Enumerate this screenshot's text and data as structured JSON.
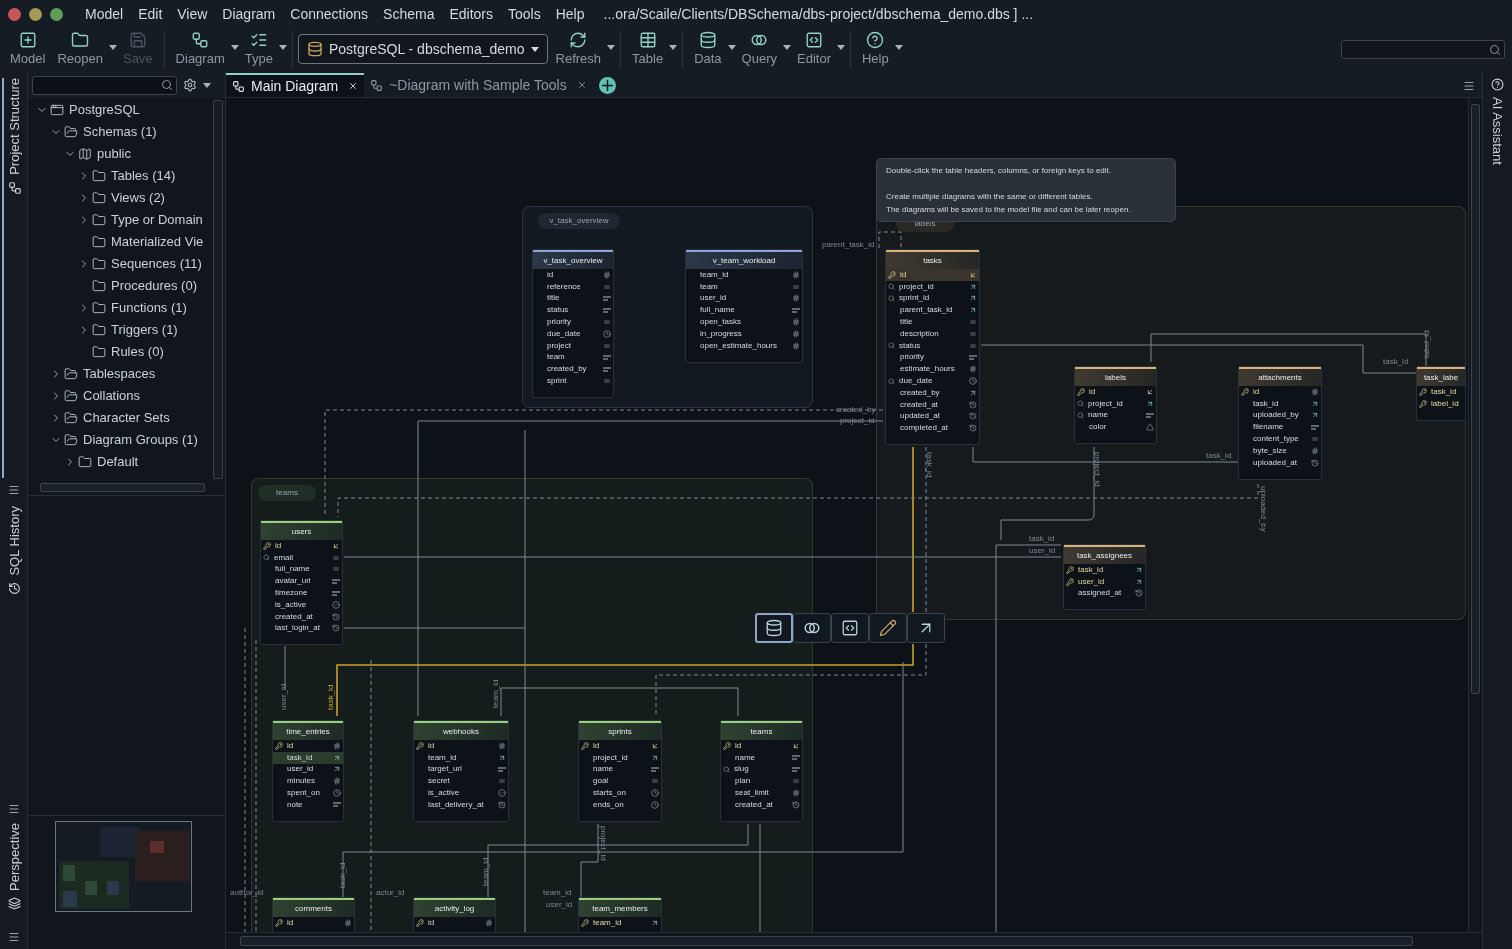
{
  "menu_bar": {
    "items": [
      "Model",
      "Edit",
      "View",
      "Diagram",
      "Connections",
      "Schema",
      "Editors",
      "Tools",
      "Help"
    ],
    "path": "...ora/Scaile/Clients/DBSchema/dbs-project/dbschema_demo.dbs ] ..."
  },
  "toolbar": {
    "buttons": [
      {
        "label": "Model",
        "disabled": false,
        "dropdown": false
      },
      {
        "label": "Reopen",
        "disabled": false,
        "dropdown": true
      },
      {
        "label": "Save",
        "disabled": true,
        "dropdown": false
      },
      {
        "label": "Diagram",
        "disabled": false,
        "dropdown": true
      },
      {
        "label": "Type",
        "disabled": false,
        "dropdown": true
      },
      {
        "label": "Refresh",
        "disabled": false,
        "dropdown": true
      },
      {
        "label": "Table",
        "disabled": false,
        "dropdown": true
      },
      {
        "label": "Data",
        "disabled": false,
        "dropdown": true
      },
      {
        "label": "Query",
        "disabled": false,
        "dropdown": true
      },
      {
        "label": "Editor",
        "disabled": false,
        "dropdown": true
      },
      {
        "label": "Help",
        "disabled": false,
        "dropdown": true
      }
    ],
    "connection": "PostgreSQL - dbschema_demo"
  },
  "side_tabs": {
    "left": [
      {
        "label": "Project Structure",
        "selected": true
      },
      {
        "label": "SQL History",
        "selected": false
      },
      {
        "label": "Perspective",
        "selected": false
      }
    ],
    "right": [
      "AI Assistant"
    ]
  },
  "tree": [
    {
      "label": "PostgreSQL",
      "kind": "database",
      "expanded": true,
      "children": [
        {
          "label": "Schemas (1)",
          "kind": "group",
          "expanded": true,
          "children": [
            {
              "label": "public",
              "kind": "schema",
              "expanded": true,
              "children": [
                {
                  "label": "Tables (14)",
                  "kind": "folder",
                  "expanded": false
                },
                {
                  "label": "Views (2)",
                  "kind": "folder",
                  "expanded": false
                },
                {
                  "label": "Type or Domain",
                  "kind": "folder",
                  "expanded": false
                },
                {
                  "label": "Materialized Vie",
                  "kind": "folder"
                },
                {
                  "label": "Sequences (11)",
                  "kind": "folder",
                  "expanded": false
                },
                {
                  "label": "Procedures (0)",
                  "kind": "folder"
                },
                {
                  "label": "Functions (1)",
                  "kind": "folder",
                  "expanded": false
                },
                {
                  "label": "Triggers (1)",
                  "kind": "folder",
                  "expanded": false
                },
                {
                  "label": "Rules (0)",
                  "kind": "folder"
                }
              ]
            }
          ]
        },
        {
          "label": "Tablespaces",
          "kind": "group",
          "expanded": false
        },
        {
          "label": "Collations",
          "kind": "group",
          "expanded": false
        },
        {
          "label": "Character Sets",
          "kind": "group",
          "expanded": false
        },
        {
          "label": "Diagram Groups (1)",
          "kind": "group",
          "expanded": true,
          "children": [
            {
              "label": "Default",
              "kind": "folder",
              "expanded": false
            }
          ]
        }
      ]
    }
  ],
  "tabs": [
    {
      "label": "Main Diagram",
      "selected": true
    },
    {
      "label": "~Diagram with Sample Tools",
      "selected": false
    }
  ],
  "diagram": {
    "groups": [
      {
        "title": "v_task_overview",
        "color": "#8fa5d8"
      },
      {
        "title": "teams",
        "color": "#9ad07a"
      },
      {
        "title": "labels",
        "color": "#d9b27a"
      }
    ],
    "tooltip": [
      "Double-click the table headers, columns, or foreign keys to edit.",
      "Create multiple diagrams with the same or different tables.",
      "The diagrams will be saved to the model file and can be later reopen."
    ],
    "tables": [
      {
        "name": "v_task_overview",
        "color": "#8fa5d8",
        "columns": [
          {
            "name": "id",
            "kind": "number",
            "pk": false,
            "indexed": false,
            "selected": false
          },
          {
            "name": "reference",
            "kind": "text",
            "pk": false,
            "indexed": false,
            "selected": false
          },
          {
            "name": "title",
            "kind": "varchar",
            "pk": false,
            "indexed": false,
            "selected": false
          },
          {
            "name": "status",
            "kind": "varchar",
            "pk": false,
            "indexed": false,
            "selected": false
          },
          {
            "name": "priority",
            "kind": "text",
            "pk": false,
            "indexed": false,
            "selected": false
          },
          {
            "name": "due_date",
            "kind": "date",
            "pk": false,
            "indexed": false,
            "selected": false
          },
          {
            "name": "project",
            "kind": "text",
            "pk": false,
            "indexed": false,
            "selected": false
          },
          {
            "name": "team",
            "kind": "varchar",
            "pk": false,
            "indexed": false,
            "selected": false
          },
          {
            "name": "created_by",
            "kind": "varchar",
            "pk": false,
            "indexed": false,
            "selected": false
          },
          {
            "name": "sprint",
            "kind": "text",
            "pk": false,
            "indexed": false,
            "selected": false
          }
        ]
      },
      {
        "name": "v_team_workload",
        "color": "#8fa5d8",
        "columns": [
          {
            "name": "team_id",
            "kind": "number",
            "pk": false,
            "indexed": false,
            "selected": false
          },
          {
            "name": "team",
            "kind": "text",
            "pk": false,
            "indexed": false,
            "selected": false
          },
          {
            "name": "user_id",
            "kind": "number",
            "pk": false,
            "indexed": false,
            "selected": false
          },
          {
            "name": "full_name",
            "kind": "varchar",
            "pk": false,
            "indexed": false,
            "selected": false
          },
          {
            "name": "open_tasks",
            "kind": "number",
            "pk": false,
            "indexed": false,
            "selected": false
          },
          {
            "name": "in_progress",
            "kind": "number",
            "pk": false,
            "indexed": false,
            "selected": false
          },
          {
            "name": "open_estimate_hours",
            "kind": "number",
            "pk": false,
            "indexed": false,
            "selected": false
          }
        ]
      },
      {
        "name": "tasks",
        "color": "#d9b27a",
        "columns": [
          {
            "name": "id",
            "kind": "ref",
            "pk": true,
            "indexed": false,
            "selected": true
          },
          {
            "name": "project_id",
            "kind": "fk",
            "pk": false,
            "indexed": true,
            "selected": false
          },
          {
            "name": "sprint_id",
            "kind": "fk",
            "pk": false,
            "indexed": true,
            "selected": false
          },
          {
            "name": "parent_task_id",
            "kind": "fk",
            "pk": false,
            "indexed": false,
            "selected": false
          },
          {
            "name": "title",
            "kind": "text",
            "pk": false,
            "indexed": false,
            "selected": false
          },
          {
            "name": "description",
            "kind": "text",
            "pk": false,
            "indexed": false,
            "selected": false
          },
          {
            "name": "status",
            "kind": "text",
            "pk": false,
            "indexed": true,
            "selected": false
          },
          {
            "name": "priority",
            "kind": "varchar",
            "pk": false,
            "indexed": false,
            "selected": false
          },
          {
            "name": "estimate_hours",
            "kind": "number",
            "pk": false,
            "indexed": false,
            "selected": false
          },
          {
            "name": "due_date",
            "kind": "date",
            "pk": false,
            "indexed": true,
            "selected": false
          },
          {
            "name": "created_by",
            "kind": "fk",
            "pk": false,
            "indexed": false,
            "selected": false
          },
          {
            "name": "created_at",
            "kind": "timestamp",
            "pk": false,
            "indexed": false,
            "selected": false
          },
          {
            "name": "updated_at",
            "kind": "timestamp",
            "pk": false,
            "indexed": false,
            "selected": false
          },
          {
            "name": "completed_at",
            "kind": "timestamp",
            "pk": false,
            "indexed": false,
            "selected": false
          }
        ]
      },
      {
        "name": "labels",
        "color": "#d9b27a",
        "columns": [
          {
            "name": "id",
            "kind": "ref",
            "pk": true,
            "indexed": false,
            "selected": false
          },
          {
            "name": "project_id",
            "kind": "fk",
            "pk": false,
            "indexed": true,
            "selected": false
          },
          {
            "name": "name",
            "kind": "varchar",
            "pk": false,
            "indexed": true,
            "selected": false
          },
          {
            "name": "color",
            "kind": "enum",
            "pk": false,
            "indexed": false,
            "selected": false
          }
        ]
      },
      {
        "name": "attachments",
        "color": "#d9b27a",
        "columns": [
          {
            "name": "id",
            "kind": "number",
            "pk": true,
            "indexed": false,
            "selected": false
          },
          {
            "name": "task_id",
            "kind": "fk",
            "pk": false,
            "indexed": false,
            "selected": false
          },
          {
            "name": "uploaded_by",
            "kind": "fk",
            "pk": false,
            "indexed": false,
            "selected": false
          },
          {
            "name": "filename",
            "kind": "varchar",
            "pk": false,
            "indexed": false,
            "selected": false
          },
          {
            "name": "content_type",
            "kind": "text",
            "pk": false,
            "indexed": false,
            "selected": false
          },
          {
            "name": "byte_size",
            "kind": "number",
            "pk": false,
            "indexed": false,
            "selected": false
          },
          {
            "name": "uploaded_at",
            "kind": "timestamp",
            "pk": false,
            "indexed": false,
            "selected": false
          }
        ]
      },
      {
        "name": "task_labe",
        "color": "#d9b27a",
        "columns": [
          {
            "name": "task_id",
            "kind": "none",
            "pk": true,
            "indexed": false,
            "selected": false
          },
          {
            "name": "label_id",
            "kind": "none",
            "pk": true,
            "indexed": false,
            "selected": false
          }
        ]
      },
      {
        "name": "task_assignees",
        "color": "#d9b27a",
        "columns": [
          {
            "name": "task_id",
            "kind": "fk",
            "pk": true,
            "indexed": false,
            "selected": false
          },
          {
            "name": "user_id",
            "kind": "fk",
            "pk": true,
            "indexed": false,
            "selected": false
          },
          {
            "name": "assigned_at",
            "kind": "timestamp",
            "pk": false,
            "indexed": false,
            "selected": false
          }
        ]
      },
      {
        "name": "users",
        "color": "#9ad07a",
        "columns": [
          {
            "name": "id",
            "kind": "ref",
            "pk": true,
            "indexed": false,
            "selected": false
          },
          {
            "name": "email",
            "kind": "text",
            "pk": false,
            "indexed": true,
            "selected": false
          },
          {
            "name": "full_name",
            "kind": "text",
            "pk": false,
            "indexed": false,
            "selected": false
          },
          {
            "name": "avatar_url",
            "kind": "varchar",
            "pk": false,
            "indexed": false,
            "selected": false
          },
          {
            "name": "timezone",
            "kind": "varchar",
            "pk": false,
            "indexed": false,
            "selected": false
          },
          {
            "name": "is_active",
            "kind": "bool",
            "pk": false,
            "indexed": false,
            "selected": false
          },
          {
            "name": "created_at",
            "kind": "timestamp",
            "pk": false,
            "indexed": false,
            "selected": false
          },
          {
            "name": "last_login_at",
            "kind": "timestamp",
            "pk": false,
            "indexed": false,
            "selected": false
          }
        ]
      },
      {
        "name": "time_entries",
        "color": "#9ad07a",
        "columns": [
          {
            "name": "id",
            "kind": "number",
            "pk": true,
            "indexed": false,
            "selected": false
          },
          {
            "name": "task_id",
            "kind": "fk",
            "pk": false,
            "indexed": false,
            "selected": true
          },
          {
            "name": "user_id",
            "kind": "fk",
            "pk": false,
            "indexed": false,
            "selected": false
          },
          {
            "name": "minutes",
            "kind": "number",
            "pk": false,
            "indexed": false,
            "selected": false
          },
          {
            "name": "spent_on",
            "kind": "date",
            "pk": false,
            "indexed": false,
            "selected": false
          },
          {
            "name": "note",
            "kind": "varchar",
            "pk": false,
            "indexed": false,
            "selected": false
          }
        ]
      },
      {
        "name": "webhooks",
        "color": "#9ad07a",
        "columns": [
          {
            "name": "id",
            "kind": "number",
            "pk": true,
            "indexed": false,
            "selected": false
          },
          {
            "name": "team_id",
            "kind": "fk",
            "pk": false,
            "indexed": false,
            "selected": false
          },
          {
            "name": "target_url",
            "kind": "varchar",
            "pk": false,
            "indexed": false,
            "selected": false
          },
          {
            "name": "secret",
            "kind": "text",
            "pk": false,
            "indexed": false,
            "selected": false
          },
          {
            "name": "is_active",
            "kind": "bool",
            "pk": false,
            "indexed": false,
            "selected": false
          },
          {
            "name": "last_delivery_at",
            "kind": "timestamp",
            "pk": false,
            "indexed": false,
            "selected": false
          }
        ]
      },
      {
        "name": "sprints",
        "color": "#9ad07a",
        "columns": [
          {
            "name": "id",
            "kind": "ref",
            "pk": true,
            "indexed": false,
            "selected": false
          },
          {
            "name": "project_id",
            "kind": "fk",
            "pk": false,
            "indexed": false,
            "selected": false
          },
          {
            "name": "name",
            "kind": "varchar",
            "pk": false,
            "indexed": false,
            "selected": false
          },
          {
            "name": "goal",
            "kind": "text",
            "pk": false,
            "indexed": false,
            "selected": false
          },
          {
            "name": "starts_on",
            "kind": "date",
            "pk": false,
            "indexed": false,
            "selected": false
          },
          {
            "name": "ends_on",
            "kind": "date",
            "pk": false,
            "indexed": false,
            "selected": false
          }
        ]
      },
      {
        "name": "teams",
        "color": "#9ad07a",
        "columns": [
          {
            "name": "id",
            "kind": "ref",
            "pk": true,
            "indexed": false,
            "selected": false
          },
          {
            "name": "name",
            "kind": "varchar",
            "pk": false,
            "indexed": false,
            "selected": false
          },
          {
            "name": "slug",
            "kind": "varchar",
            "pk": false,
            "indexed": true,
            "selected": false
          },
          {
            "name": "plan",
            "kind": "text",
            "pk": false,
            "indexed": false,
            "selected": false
          },
          {
            "name": "seat_limit",
            "kind": "number",
            "pk": false,
            "indexed": false,
            "selected": false
          },
          {
            "name": "created_at",
            "kind": "timestamp",
            "pk": false,
            "indexed": false,
            "selected": false
          }
        ]
      },
      {
        "name": "comments",
        "color": "#9ad07a",
        "columns": [
          {
            "name": "id",
            "kind": "number",
            "pk": true,
            "indexed": false,
            "selected": false
          }
        ]
      },
      {
        "name": "activity_log",
        "color": "#9ad07a",
        "columns": [
          {
            "name": "id",
            "kind": "number",
            "pk": true,
            "indexed": false,
            "selected": false
          }
        ]
      },
      {
        "name": "team_members",
        "color": "#9ad07a",
        "columns": [
          {
            "name": "team_id",
            "kind": "fk",
            "pk": true,
            "indexed": false,
            "selected": false
          }
        ]
      }
    ],
    "connector_labels": [
      "parent_task_id",
      "created_by",
      "project_id",
      "task_id",
      "project_id",
      "task_id",
      "uploaded_by",
      "task_id",
      "label_id",
      "task_id",
      "user_id",
      "user_id",
      "task_id",
      "team_id",
      "task_id",
      "author_id",
      "actor_id",
      "team_id",
      "project_id",
      "team_id",
      "user_id"
    ],
    "floating_toolbar": [
      {
        "selected": true
      },
      {
        "selected": false
      },
      {
        "selected": false
      },
      {
        "selected": false
      },
      {
        "selected": false
      }
    ]
  }
}
